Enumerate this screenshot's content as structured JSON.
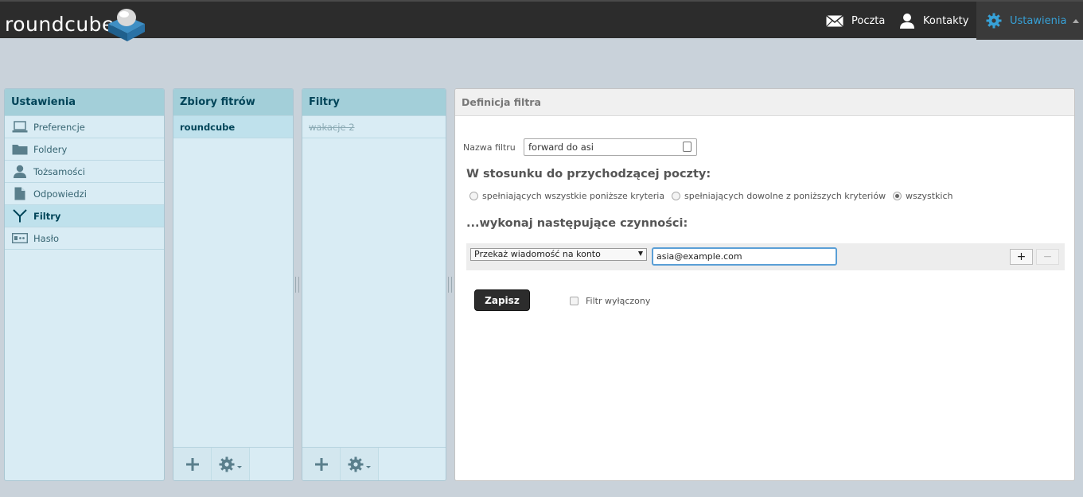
{
  "header": {
    "logo_text": "roundcube",
    "nav": {
      "mail": "Poczta",
      "contacts": "Kontakty",
      "settings": "Ustawienia"
    },
    "active_color": "#37a1d7"
  },
  "settings_panel": {
    "title": "Ustawienia",
    "items": [
      {
        "label": "Preferencje",
        "icon": "laptop-icon"
      },
      {
        "label": "Foldery",
        "icon": "folder-icon"
      },
      {
        "label": "Tożsamości",
        "icon": "person-icon"
      },
      {
        "label": "Odpowiedzi",
        "icon": "document-icon"
      },
      {
        "label": "Filtry",
        "icon": "filter-icon",
        "selected": true
      },
      {
        "label": "Hasło",
        "icon": "password-icon"
      }
    ]
  },
  "filter_sets_panel": {
    "title": "Zbiory fitrów",
    "items": [
      {
        "label": "roundcube",
        "selected": true
      }
    ]
  },
  "filters_panel": {
    "title": "Filtry",
    "items": [
      {
        "label": "wakacje 2",
        "disabled": true
      }
    ]
  },
  "definition": {
    "title": "Definicja filtra",
    "name_label": "Nazwa filtru",
    "name_value": "forward do asi",
    "incoming_heading": "W stosunku do przychodzącej poczty:",
    "match_options": [
      {
        "label": "spełniających wszystkie poniższe kryteria",
        "checked": false
      },
      {
        "label": "spełniających dowolne z poniższych kryteriów",
        "checked": false
      },
      {
        "label": "wszystkich",
        "checked": true
      }
    ],
    "actions_heading": "...wykonaj następujące czynności:",
    "action_select": "Przekaż wiadomość na konto",
    "action_target": "asia@example.com",
    "add_symbol": "+",
    "remove_symbol": "−",
    "save_label": "Zapisz",
    "disabled_label": "Filtr wyłączony"
  }
}
